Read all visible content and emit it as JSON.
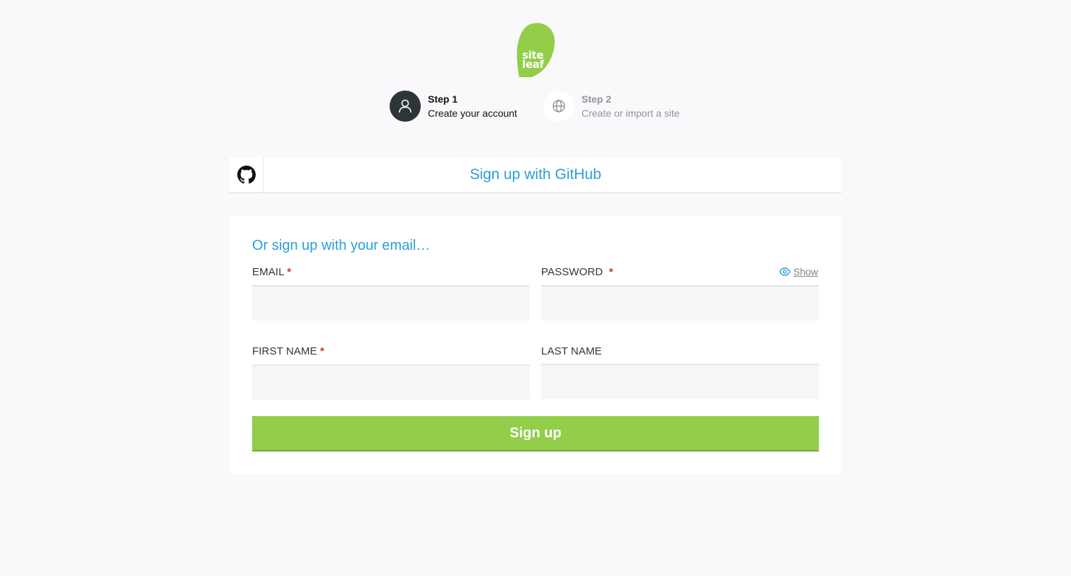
{
  "logo": {
    "line1": "site",
    "line2": "leaf",
    "color": "#92ce4a"
  },
  "steps": [
    {
      "title": "Step 1",
      "subtitle": "Create your account",
      "icon": "user-icon",
      "active": true
    },
    {
      "title": "Step 2",
      "subtitle": "Create or import a site",
      "icon": "globe-icon",
      "active": false
    }
  ],
  "github": {
    "label": "Sign up with GitHub",
    "icon": "github-icon"
  },
  "form": {
    "heading": "Or sign up with your email…",
    "email": {
      "label": "EMAIL",
      "required_mark": "*",
      "value": "",
      "placeholder": ""
    },
    "password": {
      "label": "PASSWORD",
      "required_mark": "*",
      "value": "",
      "placeholder": "",
      "show_label": "Show",
      "show_icon": "eye-icon"
    },
    "first_name": {
      "label": "FIRST NAME",
      "required_mark": "*",
      "value": "",
      "placeholder": ""
    },
    "last_name": {
      "label": "LAST NAME",
      "value": "",
      "placeholder": ""
    },
    "submit_label": "Sign up"
  },
  "colors": {
    "accent_blue": "#2a9fd6",
    "brand_green": "#92ce4a",
    "required_red": "#c0392b",
    "dark_step": "#2e3538"
  }
}
